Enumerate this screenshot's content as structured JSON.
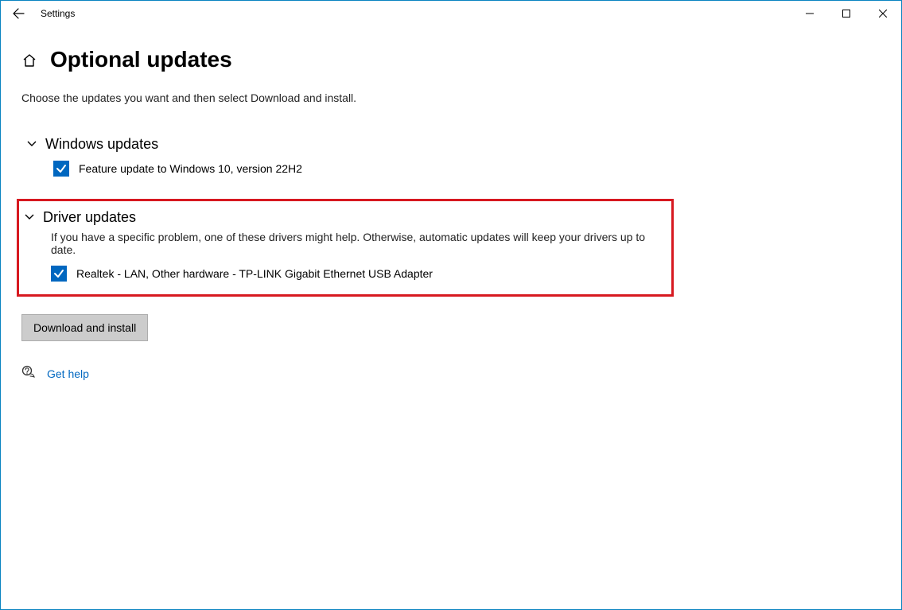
{
  "titlebar": {
    "app_title": "Settings"
  },
  "page": {
    "heading": "Optional updates",
    "instruction": "Choose the updates you want and then select Download and install."
  },
  "sections": {
    "windows_updates": {
      "title": "Windows updates",
      "items": [
        {
          "label": "Feature update to Windows 10, version 22H2",
          "checked": true
        }
      ]
    },
    "driver_updates": {
      "title": "Driver updates",
      "description": "If you have a specific problem, one of these drivers might help. Otherwise, automatic updates will keep your drivers up to date.",
      "items": [
        {
          "label": "Realtek - LAN, Other hardware - TP-LINK Gigabit Ethernet USB Adapter",
          "checked": true
        }
      ]
    }
  },
  "actions": {
    "download_install": "Download and install"
  },
  "help": {
    "link_label": "Get help"
  }
}
